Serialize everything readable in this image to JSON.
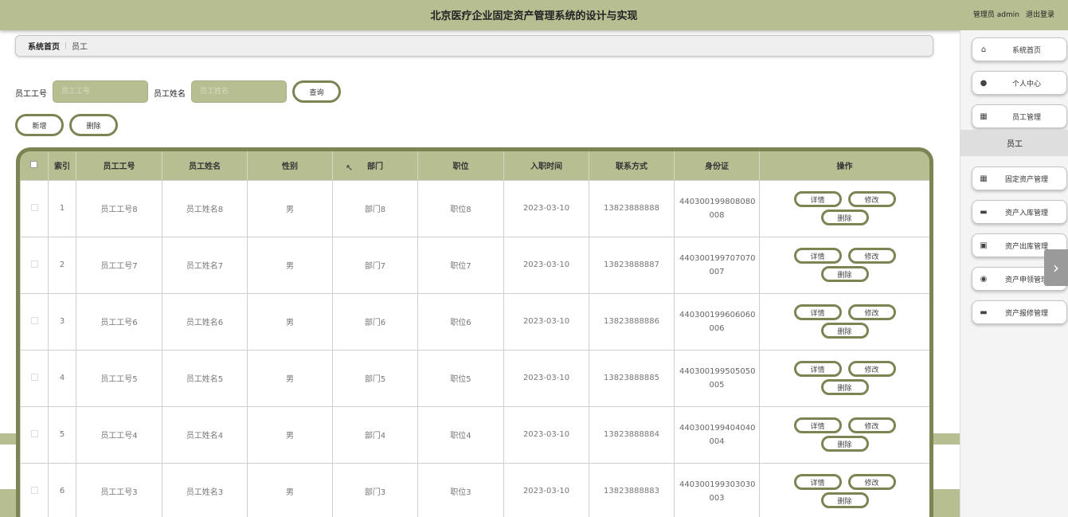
{
  "header": {
    "title": "北京医疗企业固定资产管理系统的设计与实现",
    "user": "管理员 admin",
    "logout": "退出登录"
  },
  "breadcrumb": {
    "home": "系统首页",
    "separator": "|",
    "current": "员工"
  },
  "search": {
    "emp_no_label": "员工工号",
    "emp_no_placeholder": "员工工号",
    "emp_name_label": "员工姓名",
    "emp_name_placeholder": "员工姓名",
    "query_button": "查询"
  },
  "actions": {
    "add": "新增",
    "delete": "删除"
  },
  "table": {
    "headers": [
      "索引",
      "员工工号",
      "员工姓名",
      "性别",
      "部门",
      "职位",
      "入职时间",
      "联系方式",
      "身份证",
      "操作"
    ],
    "op_labels": {
      "detail": "详情",
      "edit": "修改",
      "delete": "删除"
    },
    "rows": [
      {
        "index": "1",
        "emp_no": "员工工号8",
        "emp_name": "员工姓名8",
        "gender": "男",
        "dept": "部门8",
        "position": "职位8",
        "join_date": "2023-03-10",
        "phone": "13823888888",
        "id_line1": "440300199808080",
        "id_line2": "008"
      },
      {
        "index": "2",
        "emp_no": "员工工号7",
        "emp_name": "员工姓名7",
        "gender": "男",
        "dept": "部门7",
        "position": "职位7",
        "join_date": "2023-03-10",
        "phone": "13823888887",
        "id_line1": "440300199707070",
        "id_line2": "007"
      },
      {
        "index": "3",
        "emp_no": "员工工号6",
        "emp_name": "员工姓名6",
        "gender": "男",
        "dept": "部门6",
        "position": "职位6",
        "join_date": "2023-03-10",
        "phone": "13823888886",
        "id_line1": "440300199606060",
        "id_line2": "006"
      },
      {
        "index": "4",
        "emp_no": "员工工号5",
        "emp_name": "员工姓名5",
        "gender": "男",
        "dept": "部门5",
        "position": "职位5",
        "join_date": "2023-03-10",
        "phone": "13823888885",
        "id_line1": "440300199505050",
        "id_line2": "005"
      },
      {
        "index": "5",
        "emp_no": "员工工号4",
        "emp_name": "员工姓名4",
        "gender": "男",
        "dept": "部门4",
        "position": "职位4",
        "join_date": "2023-03-10",
        "phone": "13823888884",
        "id_line1": "440300199404040",
        "id_line2": "004"
      },
      {
        "index": "6",
        "emp_no": "员工工号3",
        "emp_name": "员工姓名3",
        "gender": "男",
        "dept": "部门3",
        "position": "职位3",
        "join_date": "2023-03-10",
        "phone": "13823888883",
        "id_line1": "440300199303030",
        "id_line2": "003"
      }
    ]
  },
  "sidebar": {
    "items": [
      {
        "label": "系统首页",
        "icon": "home-icon"
      },
      {
        "label": "个人中心",
        "icon": "user-icon"
      },
      {
        "label": "员工管理",
        "icon": "grid-icon"
      },
      {
        "label": "固定资产管理",
        "icon": "grid-icon"
      },
      {
        "label": "资产入库管理",
        "icon": "message-icon"
      },
      {
        "label": "资产出库管理",
        "icon": "clipboard-icon"
      },
      {
        "label": "资产申领管理",
        "icon": "location-icon"
      },
      {
        "label": "资产报修管理",
        "icon": "monitor-icon"
      }
    ],
    "active_sub": "员工"
  },
  "colors": {
    "accent": "#b7bf92",
    "accent_dark": "#7d8453"
  }
}
